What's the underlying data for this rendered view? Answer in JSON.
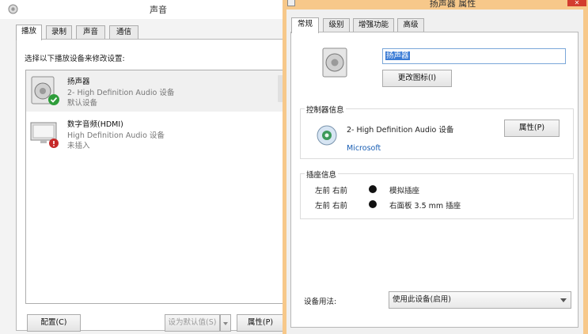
{
  "sound": {
    "title": "声音",
    "tabs": [
      {
        "label": "播放",
        "active": true
      },
      {
        "label": "录制",
        "active": false
      },
      {
        "label": "声音",
        "active": false
      },
      {
        "label": "通信",
        "active": false
      }
    ],
    "instruction": "选择以下播放设备来修改设置:",
    "devices": [
      {
        "name": "扬声器",
        "line1": "2- High Definition Audio 设备",
        "line2": "默认设备",
        "status_icon": "check-icon",
        "selected": true
      },
      {
        "name": "数字音频(HDMI)",
        "line1": "High Definition Audio 设备",
        "line2": "未插入",
        "status_icon": "unplugged-icon",
        "selected": false
      }
    ],
    "buttons": {
      "configure": "配置(C)",
      "set_default": "设为默认值(S)",
      "properties": "属性(P)"
    }
  },
  "props": {
    "title": "扬声器 属性",
    "close_label": "✕",
    "tabs": [
      {
        "label": "常规",
        "active": true
      },
      {
        "label": "级别",
        "active": false
      },
      {
        "label": "增强功能",
        "active": false
      },
      {
        "label": "高级",
        "active": false
      }
    ],
    "device_name_value": "扬声器",
    "change_icon_label": "更改图标(I)",
    "controller": {
      "group_label": "控制器信息",
      "name": "2- High Definition Audio 设备",
      "vendor": "Microsoft",
      "properties_label": "属性(P)"
    },
    "jack": {
      "group_label": "插座信息",
      "rows": [
        {
          "position": "左前 右前",
          "description": "模拟插座"
        },
        {
          "position": "左前 右前",
          "description": "右面板 3.5 mm 插座"
        }
      ]
    },
    "usage": {
      "label": "设备用法:",
      "selected": "使用此设备(启用)"
    }
  },
  "colors": {
    "accent": "#3a7bd5",
    "link": "#1a5fb4",
    "close": "#d33c2f",
    "check": "#2e9d3a",
    "unplugged": "#c62828"
  }
}
